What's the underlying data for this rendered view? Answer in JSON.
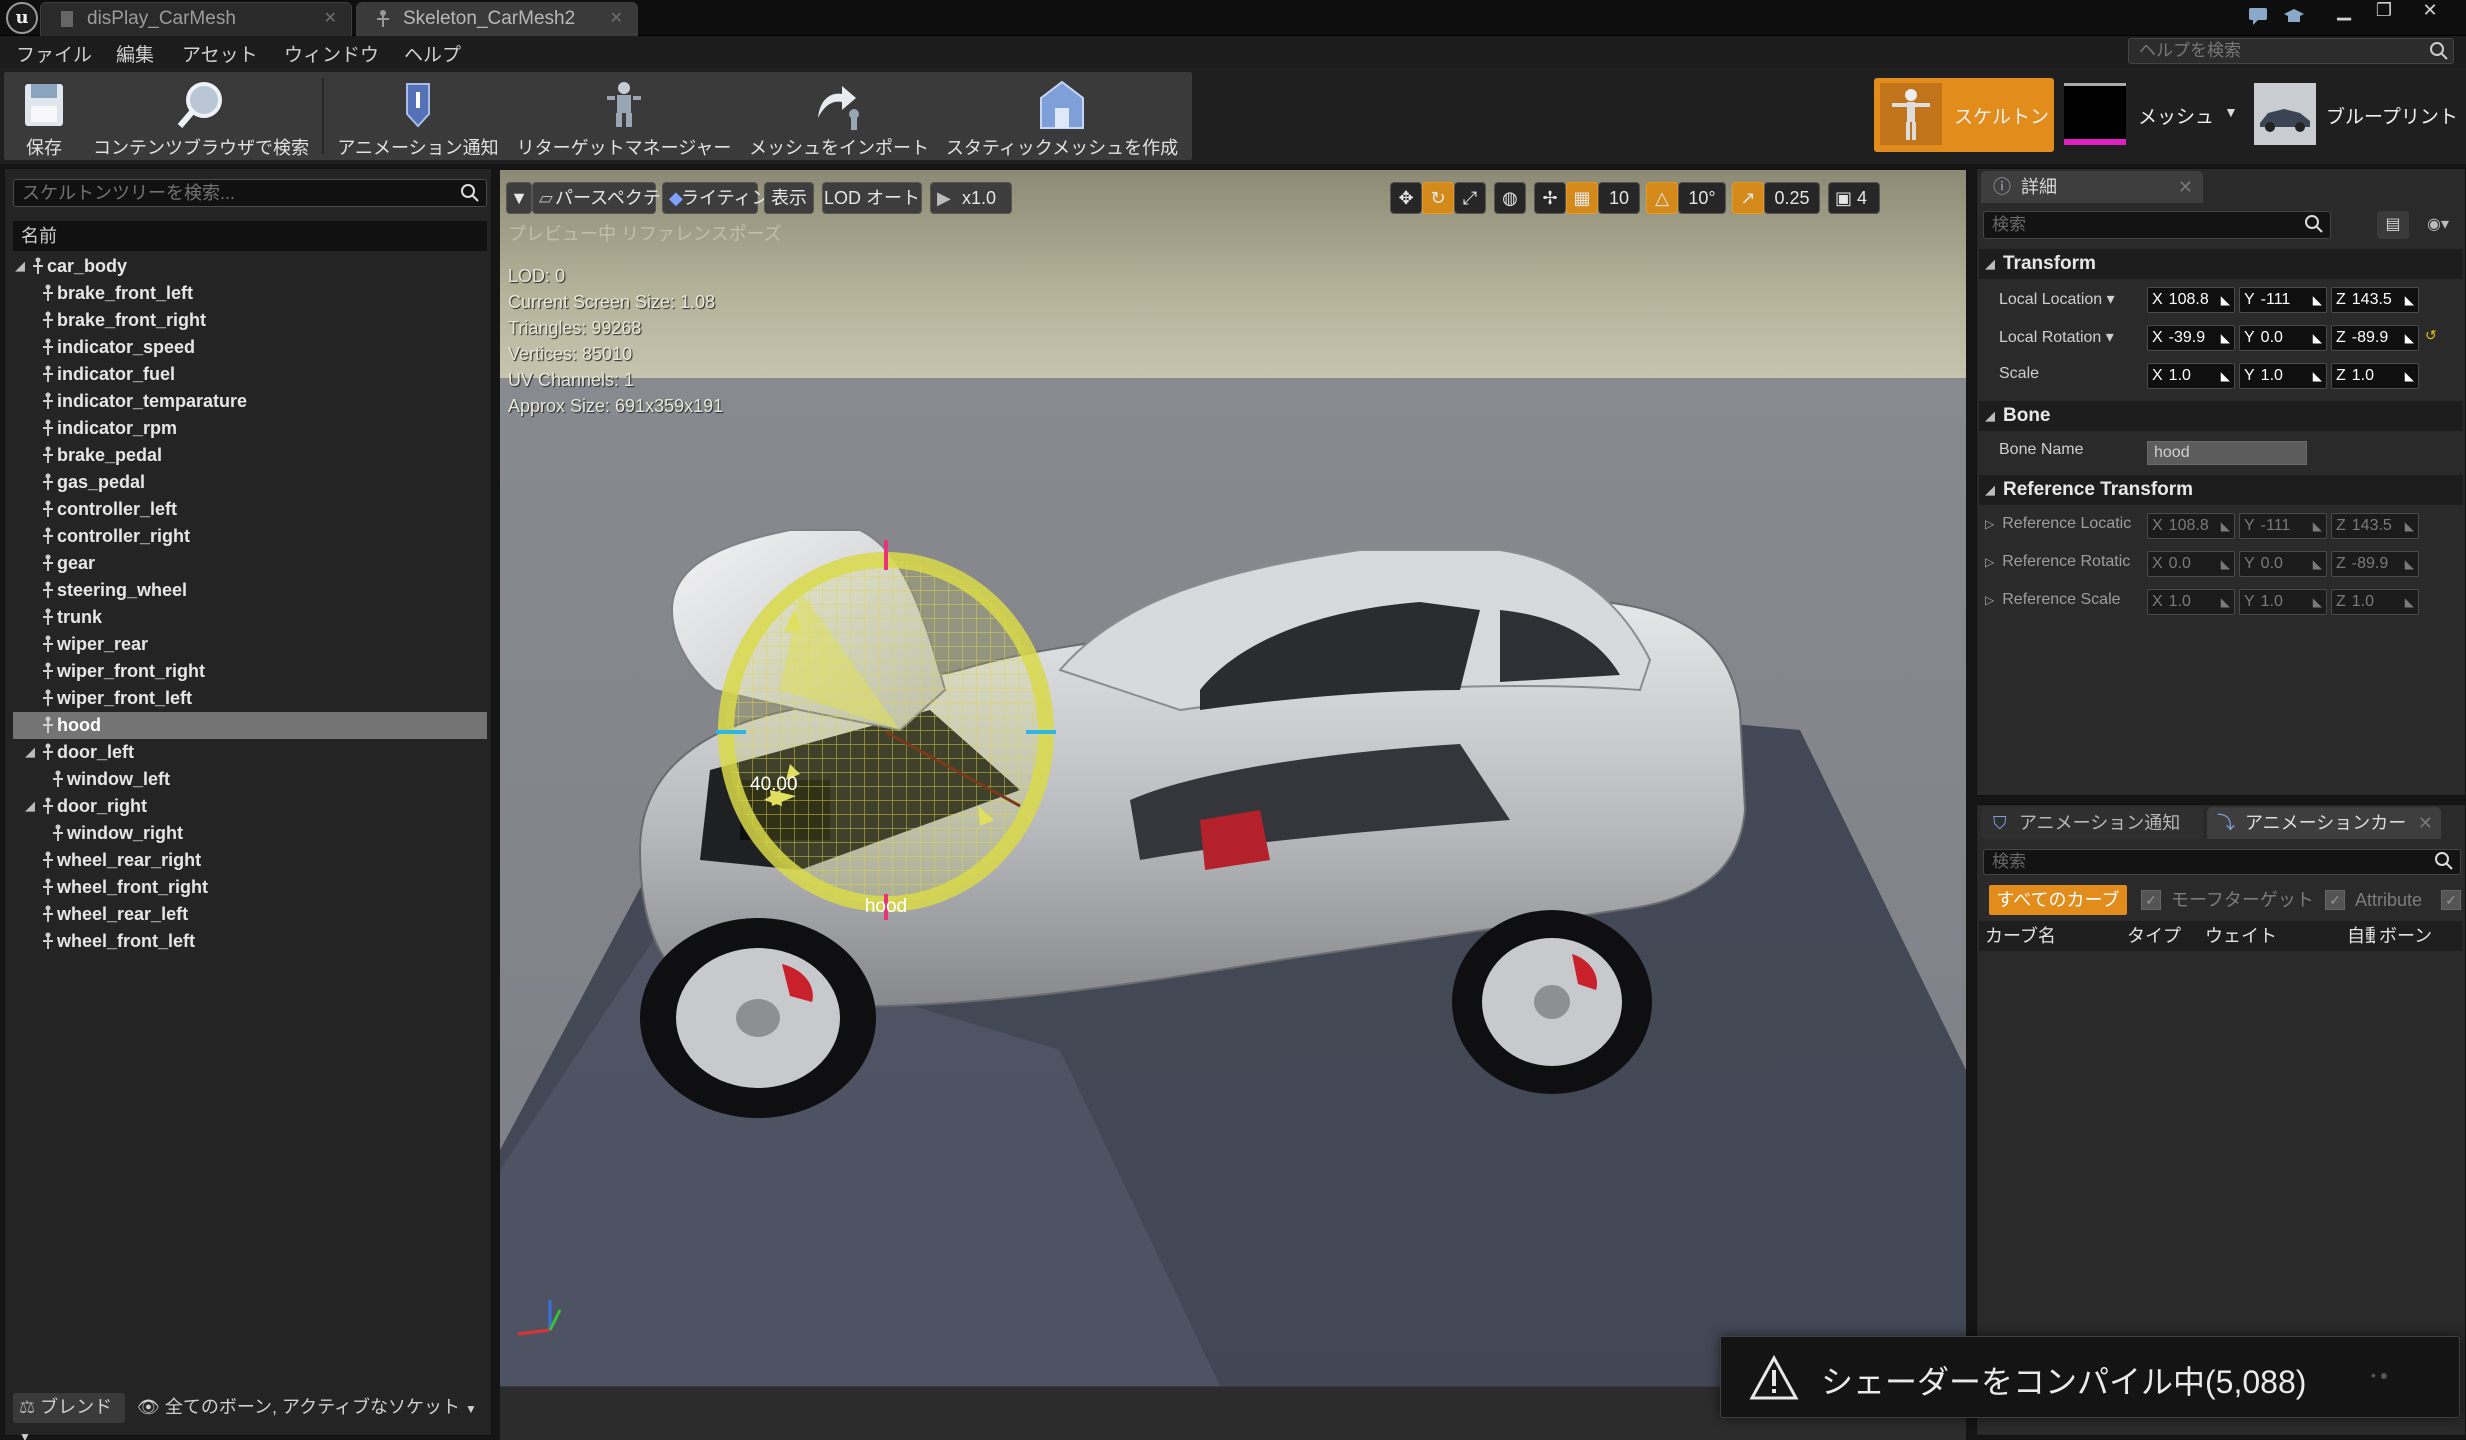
{
  "tabs": [
    {
      "label": "disPlay_CarMesh"
    },
    {
      "label": "Skeleton_CarMesh2"
    }
  ],
  "menu": [
    "ファイル",
    "編集",
    "アセット",
    "ウィンドウ",
    "ヘルプ"
  ],
  "help_search_placeholder": "ヘルプを検索",
  "toolbar": {
    "save": "保存",
    "browse": "コンテンツブラウザで検索",
    "anim_notify": "アニメーション通知",
    "retarget": "リターゲットマネージャー",
    "import_mesh": "メッシュをインポート",
    "static_mesh": "スタティックメッシュを作成"
  },
  "modes": {
    "skeleton": "スケルトン",
    "mesh": "メッシュ",
    "blueprint": "ブループリント"
  },
  "skeleton_tree": {
    "search_placeholder": "スケルトンツリーを検索...",
    "header": "名前",
    "bones": [
      {
        "name": "car_body",
        "depth": 0,
        "expanded": true
      },
      {
        "name": "brake_front_left",
        "depth": 1
      },
      {
        "name": "brake_front_right",
        "depth": 1
      },
      {
        "name": "indicator_speed",
        "depth": 1
      },
      {
        "name": "indicator_fuel",
        "depth": 1
      },
      {
        "name": "indicator_temparature",
        "depth": 1
      },
      {
        "name": "indicator_rpm",
        "depth": 1
      },
      {
        "name": "brake_pedal",
        "depth": 1
      },
      {
        "name": "gas_pedal",
        "depth": 1
      },
      {
        "name": "controller_left",
        "depth": 1
      },
      {
        "name": "controller_right",
        "depth": 1
      },
      {
        "name": "gear",
        "depth": 1
      },
      {
        "name": "steering_wheel",
        "depth": 1
      },
      {
        "name": "trunk",
        "depth": 1
      },
      {
        "name": "wiper_rear",
        "depth": 1
      },
      {
        "name": "wiper_front_right",
        "depth": 1
      },
      {
        "name": "wiper_front_left",
        "depth": 1
      },
      {
        "name": "hood",
        "depth": 1,
        "selected": true
      },
      {
        "name": "door_left",
        "depth": 1,
        "expanded": true
      },
      {
        "name": "window_left",
        "depth": 2
      },
      {
        "name": "door_right",
        "depth": 1,
        "expanded": true
      },
      {
        "name": "window_right",
        "depth": 2
      },
      {
        "name": "wheel_rear_right",
        "depth": 1
      },
      {
        "name": "wheel_front_right",
        "depth": 1
      },
      {
        "name": "wheel_rear_left",
        "depth": 1
      },
      {
        "name": "wheel_front_left",
        "depth": 1
      }
    ],
    "footer_blend": "ブレンド",
    "footer_filter": "全てのボーン, アクティブなソケット"
  },
  "viewport": {
    "perspective": "パースペクティブ",
    "lighting": "ライティング",
    "show": "表示",
    "lod": "LOD オート",
    "speed": "x1.0",
    "grid_snap": "10",
    "rot_snap": "10°",
    "scale_snap": "0.25",
    "cam_speed": "4",
    "overlay_title": "プレビュー中 リファレンスポーズ",
    "stats": [
      "LOD: 0",
      "Current Screen Size: 1.08",
      "Triangles: 99268",
      "Vertices: 85010",
      "UV Channels: 1",
      "Approx Size: 691x359x191"
    ],
    "gizmo_angle": "40.00",
    "gizmo_bone": "hood"
  },
  "details": {
    "tab": "詳細",
    "search_placeholder": "検索",
    "transform_header": "Transform",
    "local_location": {
      "label": "Local Location",
      "x": "108.8",
      "y": "-111",
      "z": "143.5"
    },
    "local_rotation": {
      "label": "Local Rotation",
      "x": "-39.9",
      "y": "0.0",
      "z": "-89.9"
    },
    "scale": {
      "label": "Scale",
      "x": "1.0",
      "y": "1.0",
      "z": "1.0"
    },
    "bone_header": "Bone",
    "bone_name_label": "Bone Name",
    "bone_name_value": "hood",
    "ref_header": "Reference Transform",
    "ref_location": {
      "label": "Reference Locatic",
      "x": "108.8",
      "y": "-111",
      "z": "143.5"
    },
    "ref_rotation": {
      "label": "Reference Rotatic",
      "x": "0.0",
      "y": "0.0",
      "z": "-89.9"
    },
    "ref_scale": {
      "label": "Reference Scale",
      "x": "1.0",
      "y": "1.0",
      "z": "1.0"
    }
  },
  "curves": {
    "tab_notify": "アニメーション通知",
    "tab_curves": "アニメーションカー",
    "search_placeholder": "検索",
    "all_curves": "すべてのカーブ",
    "morph_target": "モーフターゲット",
    "attribute": "Attribute",
    "columns": [
      "カーブ名",
      "タイプ",
      "ウェイト",
      "自動",
      "ボーン"
    ]
  },
  "toast": "シェーダーをコンパイル中(5,088)",
  "colors": {
    "accent_orange": "#e28c1b",
    "selection_gray": "#747474",
    "gizmo_yellow": "#d9d94a",
    "axis_x": "#e03030",
    "axis_y": "#3cc03c",
    "axis_z": "#3a6fe0"
  }
}
